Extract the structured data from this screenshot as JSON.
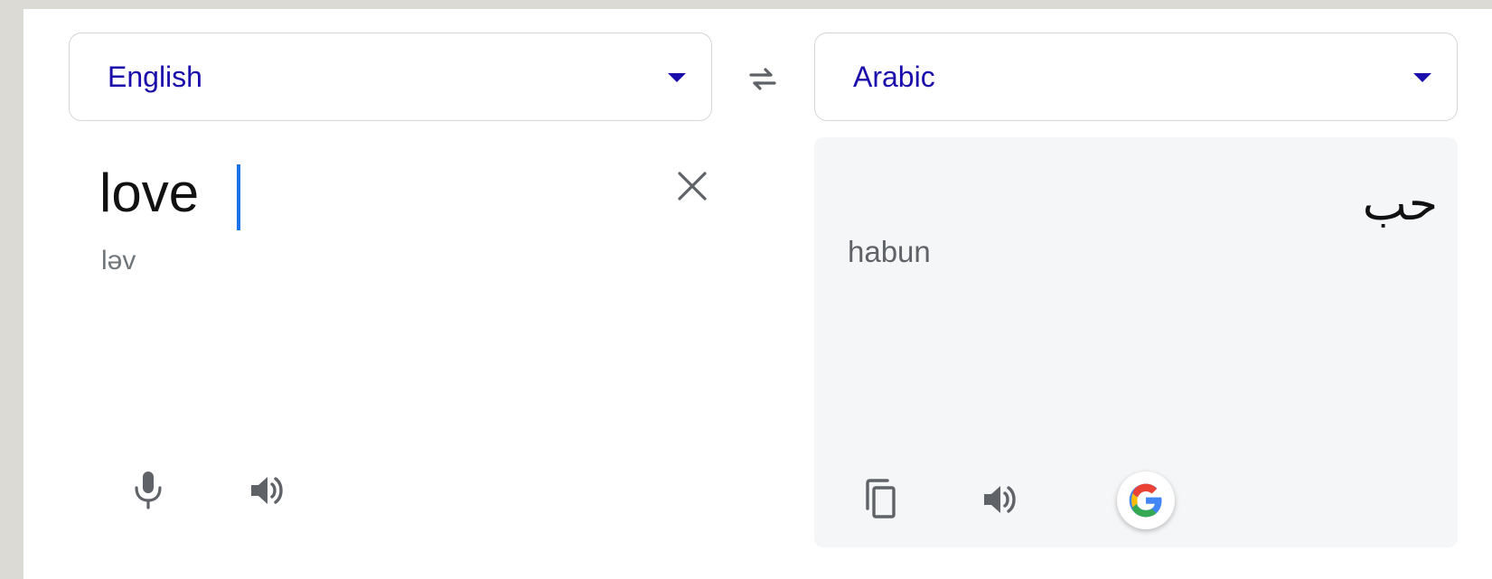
{
  "source": {
    "language": "English",
    "text": "love",
    "phonetic": "ləv"
  },
  "target": {
    "language": "Arabic",
    "text": "حب",
    "transliteration": "habun"
  },
  "icons": {
    "swap": "swap-arrows-icon",
    "clear": "close-icon",
    "mic": "microphone-icon",
    "speaker": "speaker-icon",
    "copy": "copy-icon",
    "google": "google-logo-icon",
    "dropdown": "caret-down-icon"
  },
  "colors": {
    "accent": "#1a0dab",
    "caret": "#1a73e8",
    "icon": "#5f6368",
    "target_panel_bg": "#f5f6f7"
  }
}
